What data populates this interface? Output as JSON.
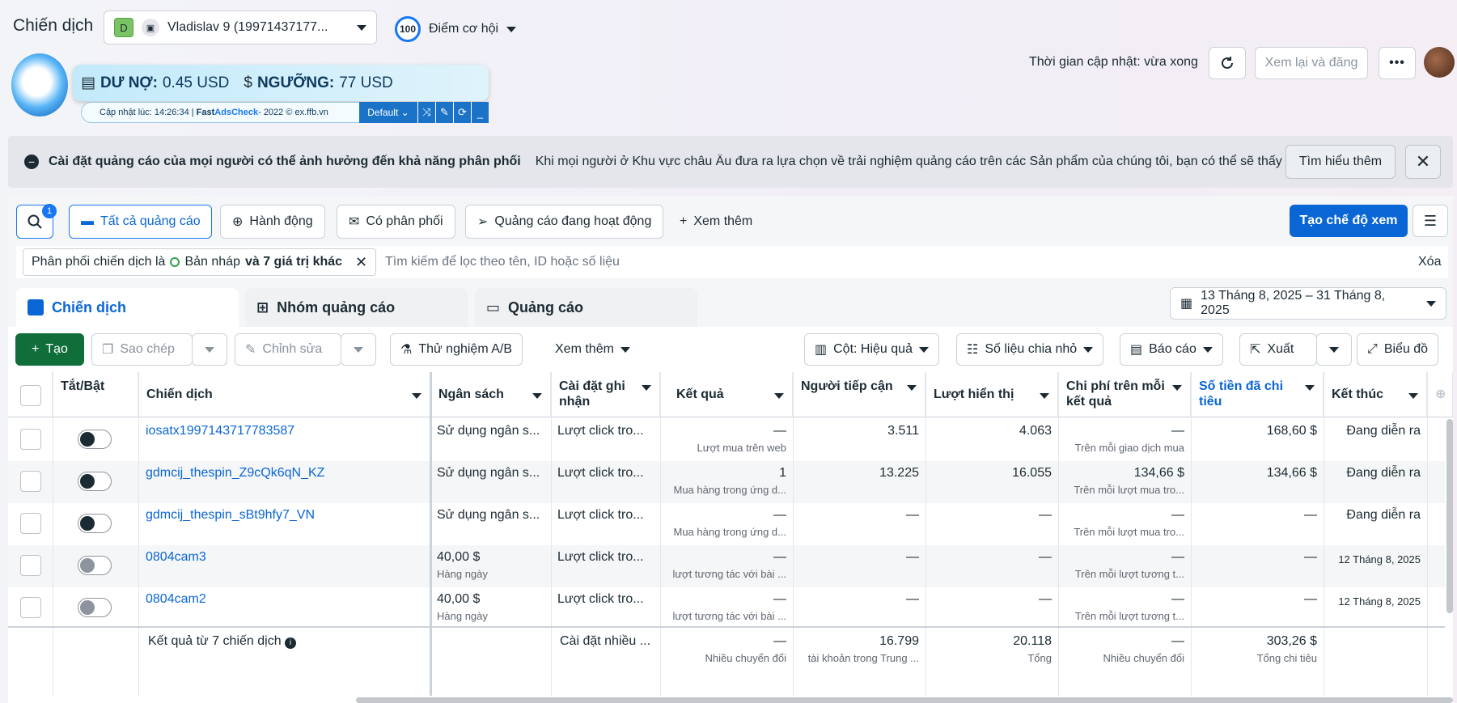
{
  "header": {
    "title": "Chiến dịch",
    "account_initial": "D",
    "account_name": "Vladislav 9 (19971437177...",
    "opportunity_score": "100",
    "opportunity_label": "Điểm cơ hội",
    "update_time": "Thời gian cập nhật: vừa xong",
    "review_label": "Xem lại và đăng",
    "more_label": "•••"
  },
  "ffb": {
    "debt_label": "DƯ NỢ:",
    "debt_value": "0.45 USD",
    "threshold_label": "NGƯỠNG:",
    "threshold_value": "77 USD",
    "updated_prefix": "Cập nhật lúc: 14:26:34 | ",
    "fast": "Fast ",
    "adscheck": "AdsCheck",
    "suffix": " - 2022 © ex.ffb.vn",
    "preset": "Default"
  },
  "banner": {
    "title": "Cài đặt quảng cáo của mọi người có thể ảnh hưởng đến khả năng phân phối",
    "text": "Khi mọi người ở Khu vực châu Âu đưa ra lựa chọn về trải nghiệm quảng cáo trên các Sản phẩm của chúng tôi, bạn có thể sẽ thấy tác đ...",
    "learn_more": "Tìm hiểu thêm"
  },
  "filters": {
    "search_badge": "1",
    "all_ads": "Tất cả quảng cáo",
    "actions": "Hành động",
    "delivering": "Có phân phối",
    "active_ads": "Quảng cáo đang hoạt động",
    "see_more": "Xem thêm",
    "create_view": "Tạo chế độ xem",
    "chip_prefix": "Phân phối chiến dịch là",
    "chip_value": "Bản nháp",
    "chip_more": "và 7 giá trị khác",
    "search_placeholder": "Tìm kiếm để lọc theo tên, ID hoặc số liệu",
    "clear": "Xóa"
  },
  "tabs": {
    "campaigns": "Chiến dịch",
    "ad_sets": "Nhóm quảng cáo",
    "ads": "Quảng cáo",
    "date_range": "13 Tháng 8, 2025 – 31 Tháng 8, 2025"
  },
  "toolbar": {
    "create": "Tạo",
    "duplicate": "Sao chép",
    "edit": "Chỉnh sửa",
    "ab_test": "Thử nghiệm A/B",
    "see_more": "Xem thêm",
    "columns": "Cột: Hiệu quả",
    "breakdown": "Số liệu chia nhỏ",
    "reports": "Báo cáo",
    "export": "Xuất",
    "chart": "Biểu đồ"
  },
  "columns": {
    "toggle": "Tắt/Bật",
    "campaign": "Chiến dịch",
    "budget": "Ngân sách",
    "attribution": "Cài đặt ghi nhận",
    "results": "Kết quả",
    "reach": "Người tiếp cận",
    "impressions": "Lượt hiển thị",
    "cost_per_result": "Chi phí trên mỗi kết quả",
    "amount_spent": "Số tiền đã chi tiêu",
    "ends": "Kết thúc"
  },
  "rows": [
    {
      "name": "iosatx1997143717783587",
      "on": true,
      "budget": "Sử dụng ngân s...",
      "budget_sub": "",
      "attr": "Lượt click tro...",
      "result": "—",
      "result_sub": "Lượt mua trên web",
      "reach": "3.511",
      "impr": "4.063",
      "cpr": "—",
      "cpr_sub": "Trên mỗi giao dịch mua",
      "spent": "168,60 $",
      "ends": "Đang diễn ra"
    },
    {
      "name": "gdmcij_thespin_Z9cQk6qN_KZ",
      "on": true,
      "budget": "Sử dụng ngân s...",
      "budget_sub": "",
      "attr": "Lượt click tro...",
      "result": "1",
      "result_sub": "Mua hàng trong ứng d...",
      "reach": "13.225",
      "impr": "16.055",
      "cpr": "134,66 $",
      "cpr_sub": "Trên mỗi lượt mua tro...",
      "spent": "134,66 $",
      "ends": "Đang diễn ra"
    },
    {
      "name": "gdmcij_thespin_sBt9hfy7_VN",
      "on": true,
      "budget": "Sử dụng ngân s...",
      "budget_sub": "",
      "attr": "Lượt click tro...",
      "result": "—",
      "result_sub": "Mua hàng trong ứng d...",
      "reach": "—",
      "impr": "—",
      "cpr": "—",
      "cpr_sub": "Trên mỗi lượt mua tro...",
      "spent": "—",
      "ends": "Đang diễn ra"
    },
    {
      "name": "0804cam3",
      "on": false,
      "budget": "40,00 $",
      "budget_sub": "Hàng ngày",
      "attr": "Lượt click tro...",
      "result": "—",
      "result_sub": "lượt tương tác với bài ...",
      "reach": "—",
      "impr": "—",
      "cpr": "—",
      "cpr_sub": "Trên mỗi lượt tương t...",
      "spent": "—",
      "ends": "12 Tháng 8, 2025"
    },
    {
      "name": "0804cam2",
      "on": false,
      "budget": "40,00 $",
      "budget_sub": "Hàng ngày",
      "attr": "Lượt click tro...",
      "result": "—",
      "result_sub": "lượt tương tác với bài ...",
      "reach": "—",
      "impr": "—",
      "cpr": "—",
      "cpr_sub": "Trên mỗi lượt tương t...",
      "spent": "—",
      "ends": "12 Tháng 8, 2025"
    }
  ],
  "totals": {
    "label": "Kết quả từ 7 chiến dịch",
    "attr": "Cài đặt nhiều ...",
    "result": "—",
    "result_sub": "Nhiều chuyển đổi",
    "reach": "16.799",
    "reach_sub": "tài khoản trong Trung ...",
    "impr": "20.118",
    "impr_sub": "Tổng",
    "cpr": "—",
    "cpr_sub": "Nhiều chuyển đổi",
    "spent": "303,26 $",
    "spent_sub": "Tổng chi tiêu"
  }
}
